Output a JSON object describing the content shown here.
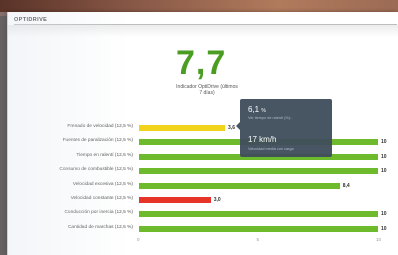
{
  "screen": {
    "title": "OPTIDRIVE"
  },
  "summary": {
    "score": "7,7",
    "caption": "Indicador OptiDrive (últimos 7 días)"
  },
  "tooltip": {
    "line1_value": "6,1",
    "line1_unit": "%",
    "line1_label": "Ver tiempo de ralentí (%)...",
    "line2_value": "17 km/h",
    "line2_label": "Velocidad media con carga"
  },
  "chart_data": {
    "type": "bar",
    "orientation": "horizontal",
    "categories": [
      "Frenado de velocidad (12,5 %)",
      "Fuentes de paralización (12,5 %)",
      "Tiempo en ralentí (12,5 %)",
      "Consumo de combustible (12,5 %)",
      "Velocidad excesiva (12,5 %)",
      "Velocidad constante (12,5 %)",
      "Conducción por inercia (12,5 %)",
      "Cantidad de marchas (12,5 %)"
    ],
    "values": [
      3.6,
      10,
      10,
      10,
      8.4,
      3.0,
      10,
      10
    ],
    "value_labels": [
      "3,6",
      "10",
      "10",
      "10",
      "8,4",
      "3,0",
      "10",
      "10"
    ],
    "colors": [
      "#f2d31b",
      "#6dba2c",
      "#6dba2c",
      "#6dba2c",
      "#6dba2c",
      "#e8352a",
      "#6dba2c",
      "#6dba2c"
    ],
    "xlim": [
      0,
      10
    ],
    "x_ticks": [
      "0",
      "5",
      "10"
    ],
    "grid": false
  }
}
